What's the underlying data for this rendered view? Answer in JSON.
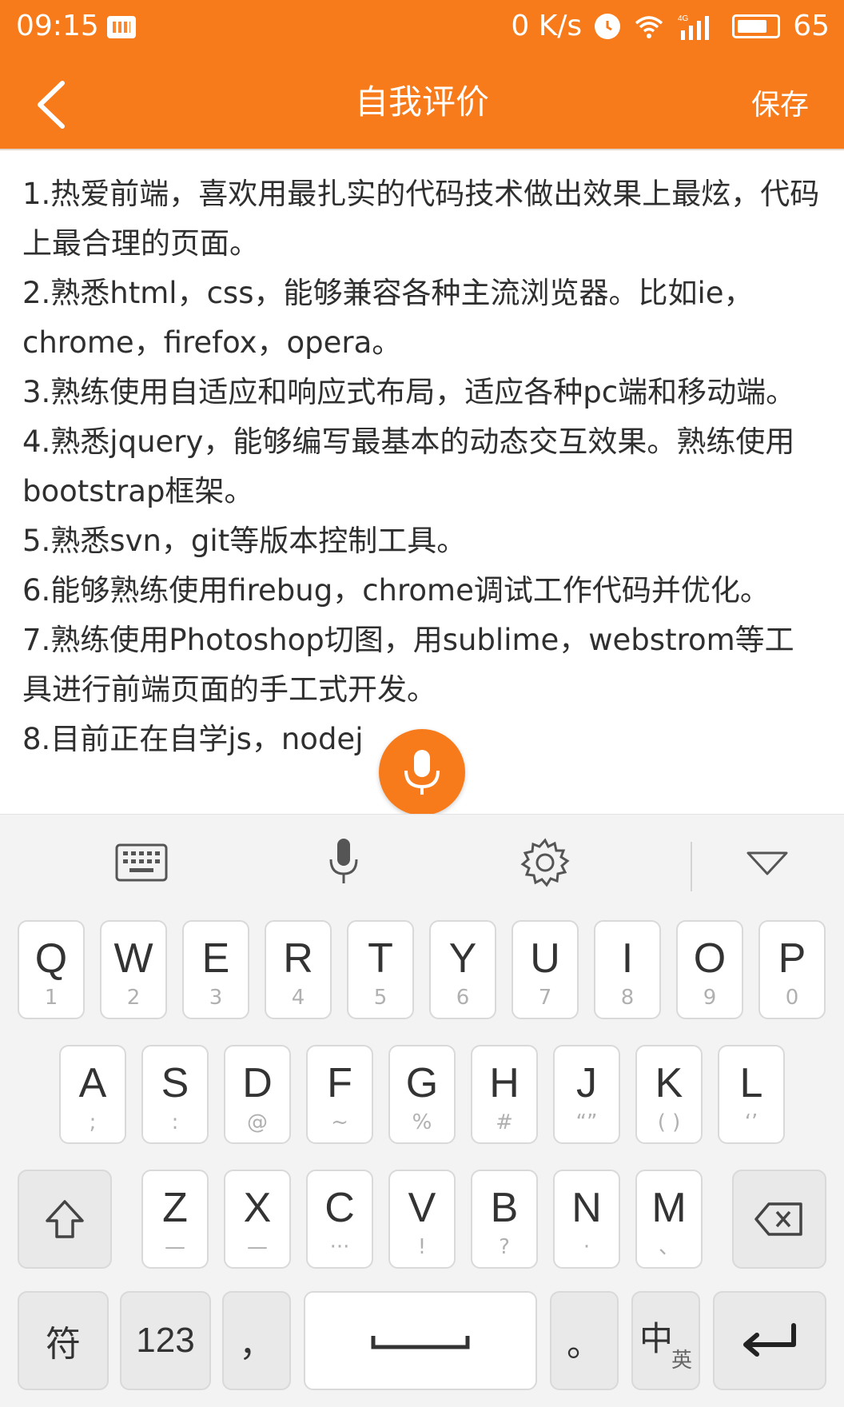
{
  "status": {
    "time": "09:15",
    "net_speed": "0 K/s",
    "battery_level": "65",
    "network_type": "4G"
  },
  "header": {
    "title": "自我评价",
    "save_label": "保存"
  },
  "content": {
    "paragraphs": [
      "1.热爱前端，喜欢用最扎实的代码技术做出效果上最炫，代码上最合理的页面。",
      "2.熟悉html，css，能够兼容各种主流浏览器。比如ie，chrome，firefox，opera。",
      "3.熟练使用自适应和响应式布局，适应各种pc端和移动端。",
      "4.熟悉jquery，能够编写最基本的动态交互效果。熟练使用bootstrap框架。",
      "5.熟悉svn，git等版本控制工具。",
      "6.能够熟练使用firebug，chrome调试工作代码并优化。",
      "7.熟练使用Photoshop切图，用sublime，webstrom等工具进行前端页面的手工式开发。",
      "8.目前正在自学js，nodej"
    ]
  },
  "keyboard": {
    "toolbar": [
      "keyboard-icon",
      "microphone-icon",
      "gear-icon",
      "collapse-icon"
    ],
    "row1": [
      {
        "k": "Q",
        "s": "1"
      },
      {
        "k": "W",
        "s": "2"
      },
      {
        "k": "E",
        "s": "3"
      },
      {
        "k": "R",
        "s": "4"
      },
      {
        "k": "T",
        "s": "5"
      },
      {
        "k": "Y",
        "s": "6"
      },
      {
        "k": "U",
        "s": "7"
      },
      {
        "k": "I",
        "s": "8"
      },
      {
        "k": "O",
        "s": "9"
      },
      {
        "k": "P",
        "s": "0"
      }
    ],
    "row2": [
      {
        "k": "A",
        "s": ";"
      },
      {
        "k": "S",
        "s": ":"
      },
      {
        "k": "D",
        "s": "@"
      },
      {
        "k": "F",
        "s": "~"
      },
      {
        "k": "G",
        "s": "%"
      },
      {
        "k": "H",
        "s": "#"
      },
      {
        "k": "J",
        "s": "“”"
      },
      {
        "k": "K",
        "s": "( )"
      },
      {
        "k": "L",
        "s": "‘’"
      }
    ],
    "row3": [
      {
        "k": "Z",
        "s": "—"
      },
      {
        "k": "X",
        "s": "—"
      },
      {
        "k": "C",
        "s": "···"
      },
      {
        "k": "V",
        "s": "!"
      },
      {
        "k": "B",
        "s": "?"
      },
      {
        "k": "N",
        "s": "·"
      },
      {
        "k": "M",
        "s": "、"
      }
    ],
    "symbol_label": "符",
    "num_label": "123",
    "comma_label": "，",
    "period_label": "。",
    "lang_label_main": "中",
    "lang_label_sub": "英"
  }
}
